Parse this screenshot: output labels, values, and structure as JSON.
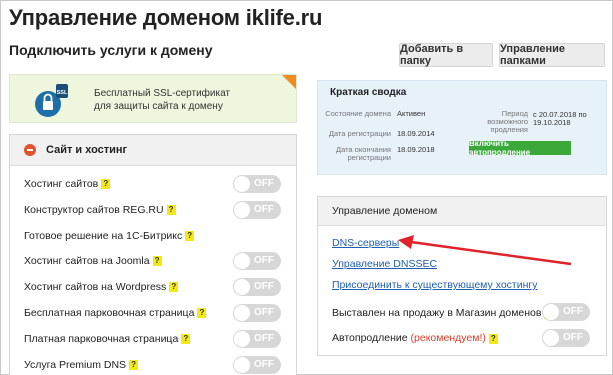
{
  "header": {
    "title": "Управление доменом iklife.ru"
  },
  "services": {
    "subtitle": "Подключить услуги к домену",
    "add_folder": "Добавить в папку",
    "manage_folders": "Управление папками"
  },
  "ssl": {
    "icon": "ssl-lock-icon",
    "badge": "SSL",
    "line1": "Бесплатный SSL-сертификат",
    "line2": "для защиты сайта к домену"
  },
  "hosting": {
    "header": "Сайт и хостинг",
    "items": [
      {
        "label": "Хостинг сайтов",
        "toggle": "OFF"
      },
      {
        "label": "Конструктор сайтов REG.RU",
        "toggle": "OFF"
      },
      {
        "label": "Готовое решение на 1С-Битрикс",
        "toggle": ""
      },
      {
        "label": "Хостинг сайтов на Joomla",
        "toggle": "OFF"
      },
      {
        "label": "Хостинг сайтов на Wordpress",
        "toggle": "OFF"
      },
      {
        "label": "Бесплатная парковочная страница",
        "toggle": "OFF"
      },
      {
        "label": "Платная парковочная страница",
        "toggle": "OFF"
      },
      {
        "label": "Услуга Premium DNS",
        "toggle": "OFF"
      }
    ]
  },
  "summary": {
    "title": "Краткая сводка",
    "status_label": "Состояние домена",
    "status_value": "Активен",
    "reg_label": "Дата регистрации",
    "reg_value": "18.09.2014",
    "end_label": "Дата окончания регистрации",
    "end_value": "18.09.2018",
    "period_label": "Период возможного продления",
    "period_from": "с 20.07.2018 по",
    "period_to": "19.10.2018",
    "autorenew_button": "Включить автопродление"
  },
  "domain_mgmt": {
    "header": "Управление доменом",
    "links": [
      "DNS-серверы",
      "Управление DNSSEC",
      "Присоединить к существующему хостингу"
    ],
    "sale_label": "Выставлен на продажу в Магазин доменов",
    "sale_toggle": "OFF",
    "autorenew_label": "Автопродление",
    "autorenew_recommended": "(рекомендуем!)",
    "autorenew_toggle": "OFF"
  },
  "colors": {
    "accent_orange": "#f08c22",
    "link_blue": "#1f5fb0",
    "annotation_red": "#e0232b",
    "green": "#3aa93a"
  }
}
